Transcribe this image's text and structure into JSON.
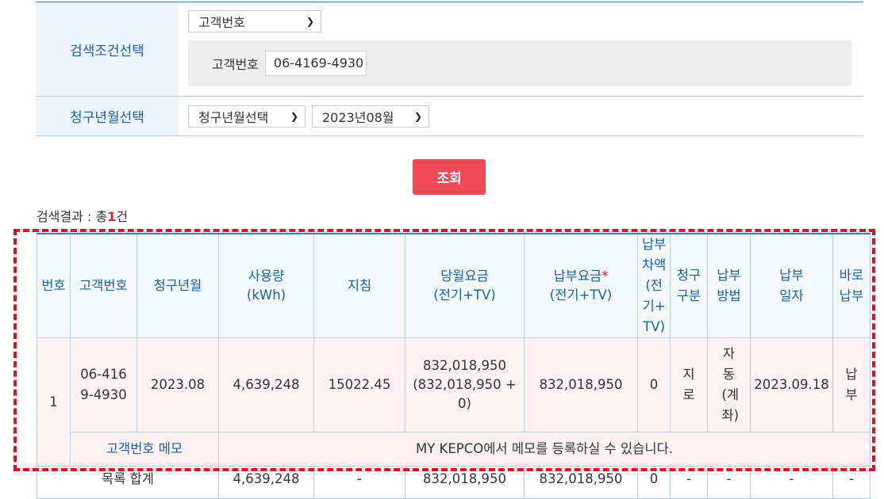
{
  "search": {
    "condition_label": "검색조건선택",
    "condition_type_selected": "고객번호",
    "customer_no_label": "고객번호",
    "customer_no_value": "06-4169-4930",
    "billing_ym_label": "청구년월선택",
    "billing_ym_type_selected": "청구년월선택",
    "billing_ym_selected": "2023년08월",
    "button_label": "조회"
  },
  "result": {
    "summary_prefix": "검색결과 : 총",
    "count": "1",
    "summary_suffix": "건"
  },
  "table": {
    "headers": {
      "no": "번호",
      "customer_no": "고객번호",
      "billing_ym": "청구년월",
      "usage": "사용량",
      "usage_unit": "(kWh)",
      "reading": "지침",
      "monthly_fee": "당월요금",
      "monthly_fee_sub": "(전기+TV)",
      "paid_fee": "납부요금",
      "paid_fee_mark": "*",
      "paid_fee_sub": "(전기+TV)",
      "diff": "납부차액(전기+TV)",
      "claim_type": "청구구분",
      "pay_method": "납부방법",
      "pay_date": "납부일자",
      "pay_now": "바로납부"
    },
    "row": {
      "no": "1",
      "customer_no": "06-4169-4930",
      "billing_ym": "2023.08",
      "usage": "4,639,248",
      "reading": "15022.45",
      "monthly_fee": "832,018,950",
      "monthly_fee_detail": "(832,018,950 + 0)",
      "paid_fee": "832,018,950",
      "diff": "0",
      "claim_type": "지로",
      "pay_method": "자동(계좌)",
      "pay_date": "2023.09.18",
      "pay_now": "납부"
    },
    "memo": {
      "label": "고객번호 메모",
      "text": "MY KEPCO에서 메모를 등록하실 수 있습니다."
    },
    "total": {
      "label": "목록 합계",
      "usage": "4,639,248",
      "reading": "-",
      "monthly_fee": "832,018,950",
      "paid_fee": "832,018,950",
      "diff": "0",
      "claim_type": "-",
      "pay_method": "-",
      "pay_date": "-",
      "pay_now": "-"
    }
  },
  "colors": {
    "accent_blue": "#1a5fa8",
    "button_red": "#ef4956",
    "highlight_dash": "#e3111c",
    "row_pink": "#fdf1f4"
  }
}
